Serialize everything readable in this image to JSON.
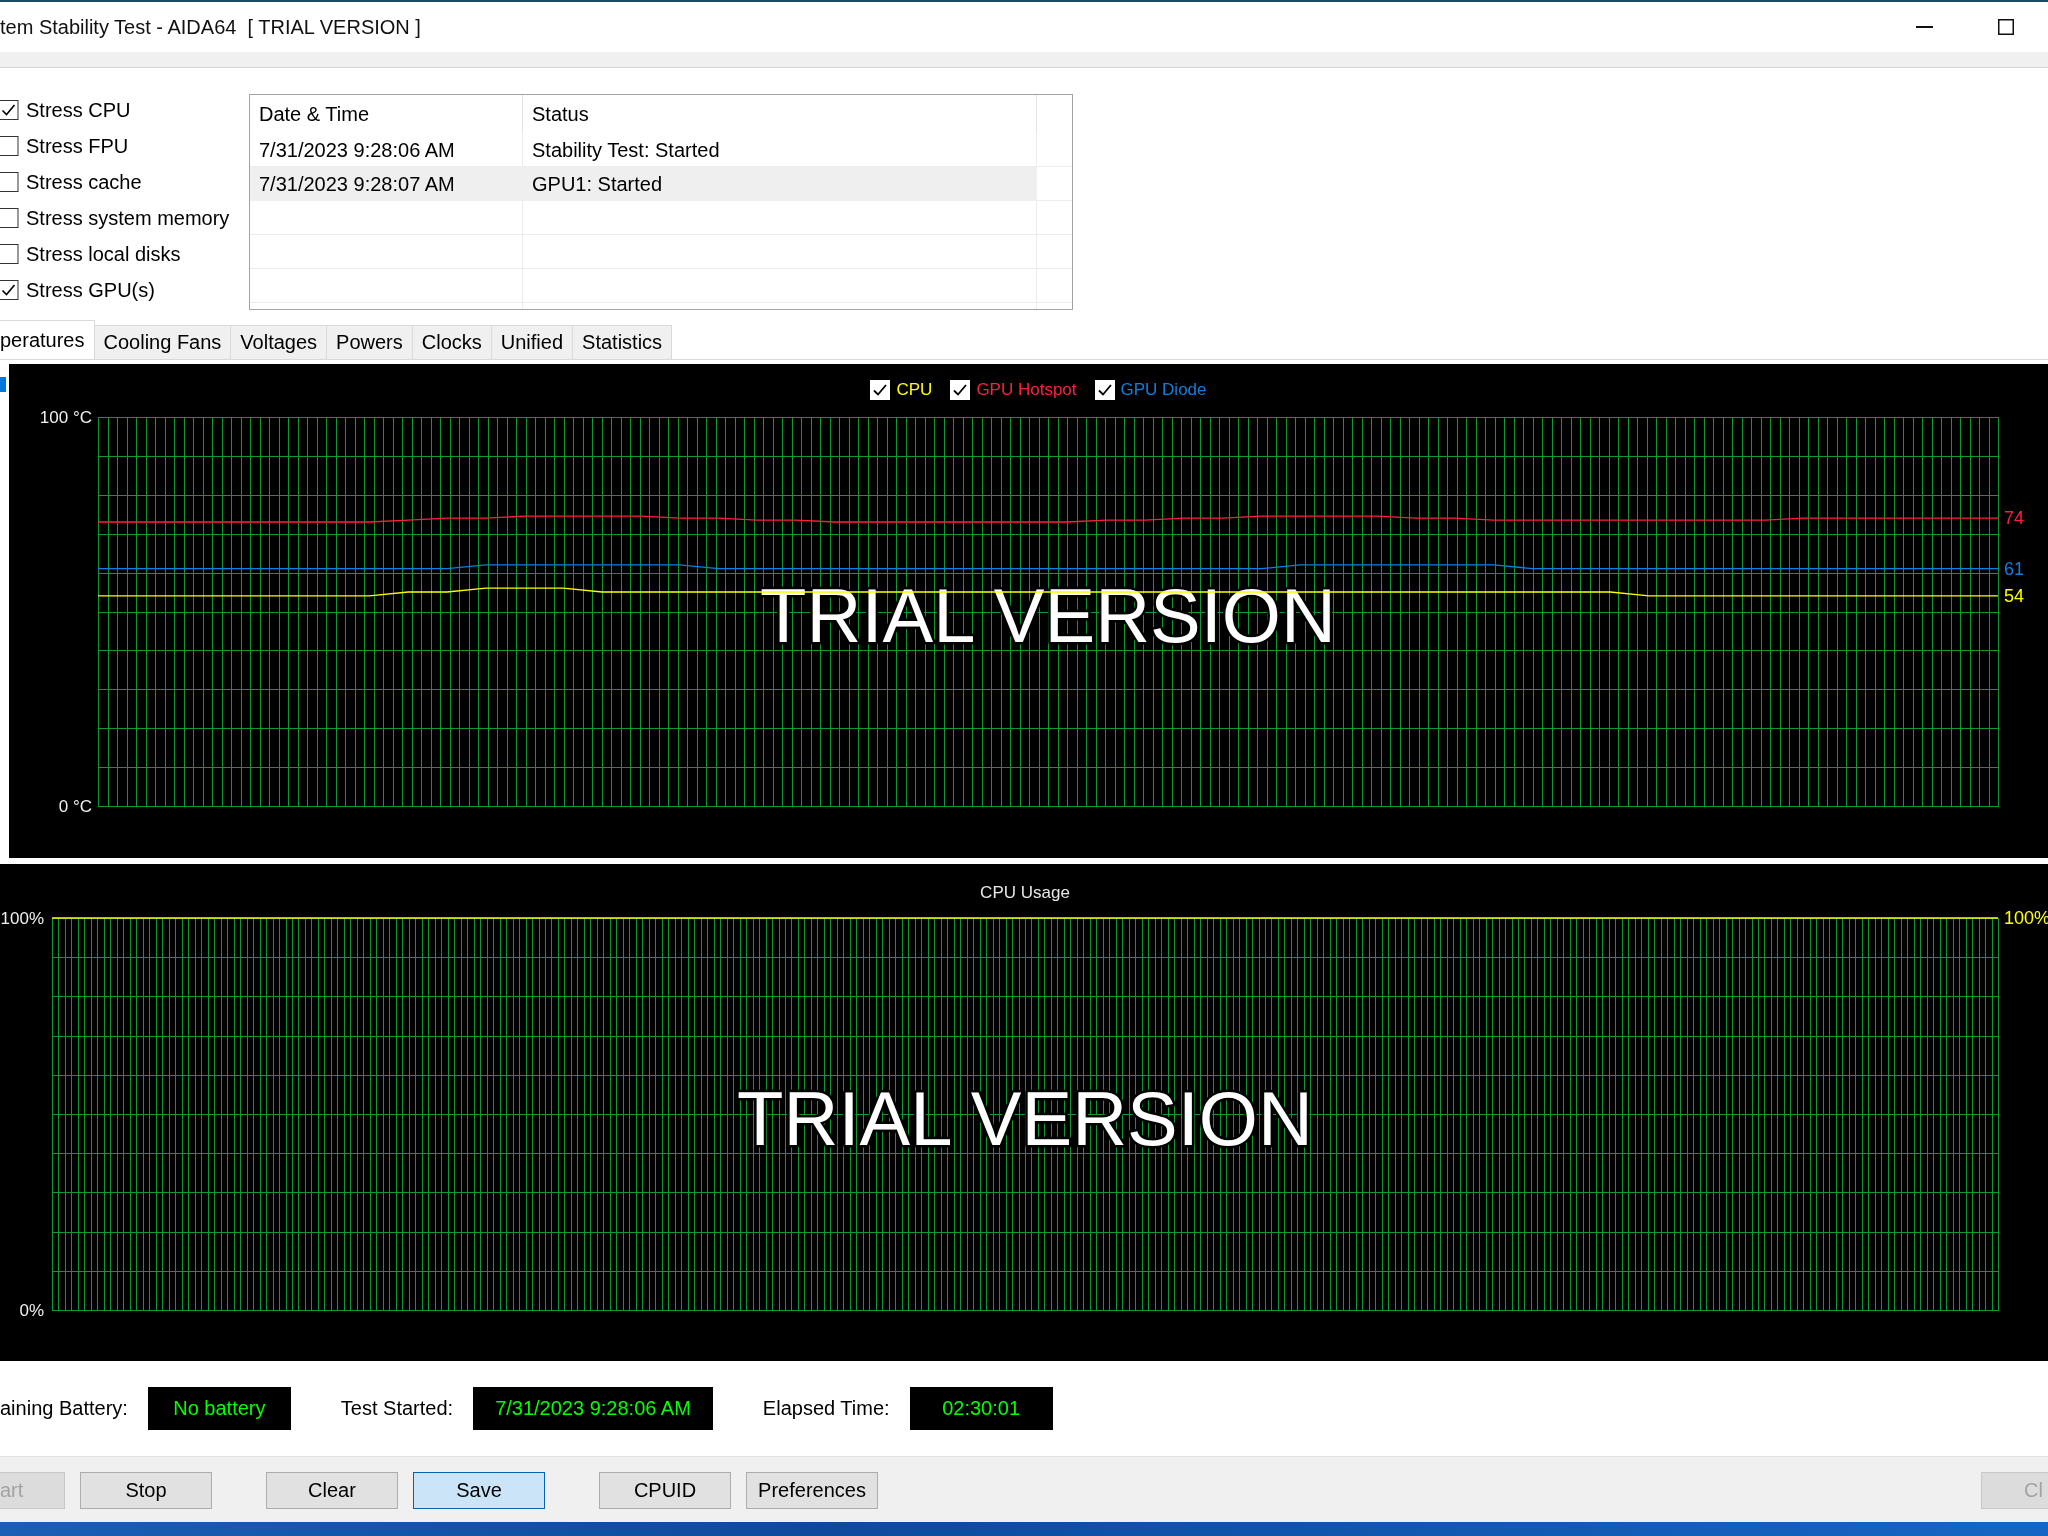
{
  "window": {
    "title": "tem Stability Test - AIDA64  [ TRIAL VERSION ]"
  },
  "stress_options": [
    {
      "label": "Stress CPU",
      "checked": true
    },
    {
      "label": "Stress FPU",
      "checked": false
    },
    {
      "label": "Stress cache",
      "checked": false
    },
    {
      "label": "Stress system memory",
      "checked": false
    },
    {
      "label": "Stress local disks",
      "checked": false
    },
    {
      "label": "Stress GPU(s)",
      "checked": true
    }
  ],
  "log": {
    "columns": [
      "Date & Time",
      "Status"
    ],
    "rows": [
      {
        "cells": [
          "7/31/2023 9:28:06 AM",
          "Stability Test: Started"
        ],
        "selected": false
      },
      {
        "cells": [
          "7/31/2023 9:28:07 AM",
          "GPU1: Started"
        ],
        "selected": true
      }
    ]
  },
  "tabs": [
    {
      "label": "peratures",
      "selected": true
    },
    {
      "label": "Cooling Fans",
      "selected": false
    },
    {
      "label": "Voltages",
      "selected": false
    },
    {
      "label": "Powers",
      "selected": false
    },
    {
      "label": "Clocks",
      "selected": false
    },
    {
      "label": "Unified",
      "selected": false
    },
    {
      "label": "Statistics",
      "selected": false
    }
  ],
  "temperature_graph": {
    "legend": [
      {
        "checked": true
      },
      {
        "checked": true
      },
      {
        "checked": true
      }
    ],
    "overlay_text": "TRIAL VERSION",
    "chart_data": {
      "type": "line",
      "grid": true,
      "ylim": [
        0,
        100
      ],
      "yticks": [
        {
          "value": 0,
          "label": "0 °C"
        },
        {
          "value": 100,
          "label": "100 °C"
        }
      ],
      "series": [
        {
          "name": "CPU",
          "color": "#ffff00",
          "values": [
            54,
            54,
            54,
            54,
            54,
            54,
            54,
            54,
            55,
            55,
            56,
            56,
            56,
            55,
            55,
            55,
            55,
            55,
            55,
            55,
            55,
            55,
            55,
            55,
            55,
            55,
            55,
            55,
            55,
            55,
            55,
            55,
            55,
            55,
            55,
            55,
            55,
            55,
            55,
            55,
            54,
            54,
            54,
            54,
            54,
            54,
            54,
            54,
            54,
            54
          ]
        },
        {
          "name": "GPU Hotspot",
          "color": "#ff1f3d",
          "values": [
            73,
            73,
            73,
            73,
            73,
            73,
            73,
            73,
            73.5,
            74,
            74,
            74.5,
            74.5,
            74.5,
            74.5,
            74,
            74,
            73.5,
            73.5,
            73,
            73,
            73,
            73,
            73,
            73,
            73,
            73.5,
            73.5,
            74,
            74,
            74.5,
            74.5,
            74.5,
            74.5,
            74,
            74,
            73.5,
            73.5,
            73.5,
            73.5,
            73.5,
            73.5,
            73.5,
            73.5,
            74,
            74,
            74,
            74,
            74,
            74
          ]
        },
        {
          "name": "GPU Diode",
          "color": "#0f7fdf",
          "values": [
            61,
            61,
            61,
            61,
            61,
            61,
            61,
            61,
            61,
            61,
            62,
            62,
            62,
            62,
            62,
            62,
            61,
            61,
            61,
            61,
            61,
            61,
            61,
            61,
            61,
            61,
            61,
            61,
            61,
            61,
            61,
            62,
            62,
            62,
            62,
            62,
            62,
            61,
            61,
            61,
            61,
            61,
            61,
            61,
            61,
            61,
            61,
            61,
            61,
            61
          ]
        }
      ]
    },
    "current_values": [
      {
        "text": "74",
        "color": "#ff1f3d"
      },
      {
        "text": "61",
        "color": "#0f7fdf"
      },
      {
        "text": "54",
        "color": "#ffff00"
      }
    ]
  },
  "cpu_usage_graph": {
    "overlay_text": "TRIAL VERSION",
    "chart_data": {
      "type": "line",
      "title": "CPU Usage",
      "grid": true,
      "ylim": [
        0,
        100
      ],
      "yticks": [
        {
          "value": 0,
          "label": "0%"
        },
        {
          "value": 100,
          "label": "100%"
        }
      ],
      "series": [
        {
          "color": "#ffff00",
          "values": [
            100,
            100,
            100,
            100,
            100,
            100,
            100,
            100,
            100,
            100,
            100,
            100,
            100,
            100,
            100,
            100,
            100,
            100,
            100,
            100
          ]
        }
      ]
    },
    "current_values": [
      {
        "text": "100%",
        "color": "#ffff00"
      }
    ]
  },
  "status": [
    {
      "label": "aining Battery:",
      "value": "No battery"
    },
    {
      "label": "Test Started:",
      "value": "7/31/2023 9:28:06 AM"
    },
    {
      "label": "Elapsed Time:",
      "value": "02:30:01"
    }
  ],
  "button_groups": [
    [
      {
        "label": "art",
        "disabled": true,
        "focused": false
      },
      {
        "label": "Stop",
        "disabled": false,
        "focused": false
      }
    ],
    [
      {
        "label": "Clear",
        "disabled": false,
        "focused": false
      },
      {
        "label": "Save",
        "disabled": false,
        "focused": true
      }
    ],
    [
      {
        "label": "CPUID",
        "disabled": false,
        "focused": false
      },
      {
        "label": "Preferences",
        "disabled": false,
        "focused": false
      }
    ],
    [
      {
        "label": "Cl",
        "disabled": true,
        "focused": false
      }
    ]
  ]
}
